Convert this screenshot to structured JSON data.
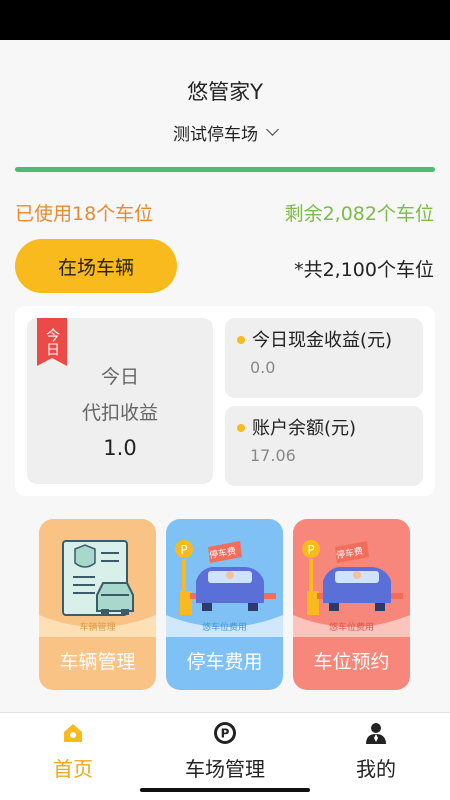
{
  "header": {
    "app_title": "悠管家Y",
    "lot_name": "测试停车场"
  },
  "colors": {
    "accent": "#f8ba1c",
    "used": "#e98a2e",
    "remain": "#7dbb48",
    "progress": "#4cbb74",
    "tile_vehicle": "#f9c385",
    "tile_fee": "#7fc1f4",
    "tile_reserve": "#f7877a",
    "badge": "#ec4a47"
  },
  "occupancy": {
    "used_text": "已使用18个车位",
    "remain_text": "剩余2,082个车位",
    "total_text": "*共2,100个车位",
    "used_fraction": 0.0086,
    "in_lot_button": "在场车辆"
  },
  "stats": {
    "today_badge": "今日",
    "withhold_line1": "今日",
    "withhold_line2": "代扣收益",
    "withhold_value": "1.0",
    "cash_label": "今日现金收益(元)",
    "cash_value": "0.0",
    "balance_label": "账户余额(元)",
    "balance_value": "17.06"
  },
  "tiles": [
    {
      "label": "车辆管理",
      "banner": "车辆管理",
      "icon": "vehicle-doc-icon"
    },
    {
      "label": "停车费用",
      "banner": "悠车位费用",
      "sign": "停车费",
      "icon": "parking-fee-icon"
    },
    {
      "label": "车位预约",
      "banner": "悠车位费用",
      "sign": "停车费",
      "icon": "parking-reserve-icon"
    }
  ],
  "tabs": [
    {
      "label": "首页",
      "icon": "home-icon",
      "active": true
    },
    {
      "label": "车场管理",
      "icon": "parking-p-icon",
      "active": false
    },
    {
      "label": "我的",
      "icon": "person-icon",
      "active": false
    }
  ]
}
